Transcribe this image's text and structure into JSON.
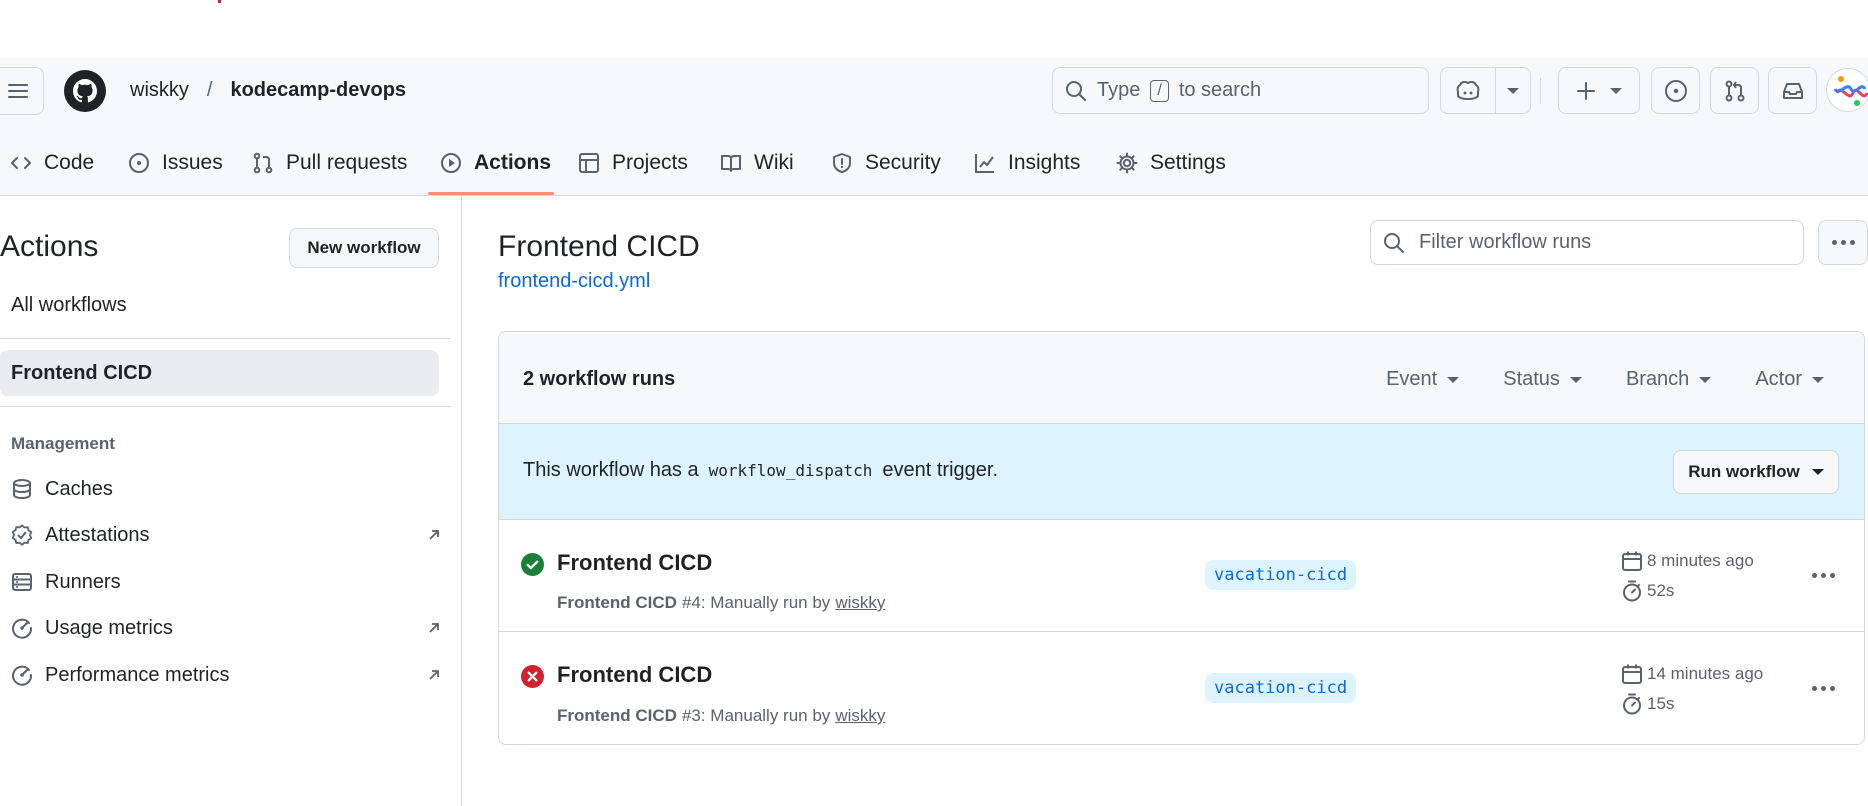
{
  "header": {
    "owner": "wiskky",
    "separator": "/",
    "repo": "kodecamp-devops",
    "search": {
      "prefix": "Type",
      "key": "/",
      "suffix": "to search"
    }
  },
  "tabs": [
    {
      "label": "Code",
      "icon": "code-icon"
    },
    {
      "label": "Issues",
      "icon": "issue-opened-icon"
    },
    {
      "label": "Pull requests",
      "icon": "git-pull-request-icon"
    },
    {
      "label": "Actions",
      "icon": "play-icon",
      "selected": true
    },
    {
      "label": "Projects",
      "icon": "table-icon"
    },
    {
      "label": "Wiki",
      "icon": "book-icon"
    },
    {
      "label": "Security",
      "icon": "shield-icon"
    },
    {
      "label": "Insights",
      "icon": "graph-icon"
    },
    {
      "label": "Settings",
      "icon": "gear-icon"
    }
  ],
  "sidebar": {
    "title": "Actions",
    "new_workflow": "New workflow",
    "all_workflows": "All workflows",
    "selected_workflow": "Frontend CICD",
    "management_heading": "Management",
    "management_items": [
      {
        "label": "Caches",
        "icon": "database-icon",
        "external": false
      },
      {
        "label": "Attestations",
        "icon": "verified-icon",
        "external": true
      },
      {
        "label": "Runners",
        "icon": "server-icon",
        "external": false
      },
      {
        "label": "Usage metrics",
        "icon": "meter-icon",
        "external": true
      },
      {
        "label": "Performance metrics",
        "icon": "meter-icon",
        "external": true
      }
    ]
  },
  "main": {
    "workflow_title": "Frontend CICD",
    "workflow_file": "frontend-cicd.yml",
    "filter_placeholder": "Filter workflow runs",
    "runs_count": "2 workflow runs",
    "filters": [
      "Event",
      "Status",
      "Branch",
      "Actor"
    ],
    "dispatch": {
      "prefix": "This workflow has a",
      "code": "workflow_dispatch",
      "suffix": "event trigger.",
      "button": "Run workflow"
    },
    "runs": [
      {
        "status": "success",
        "title": "Frontend CICD",
        "workflow": "Frontend CICD",
        "detail": "#4: Manually run by",
        "actor": "wiskky",
        "branch": "vacation-cicd",
        "time_ago": "8 minutes ago",
        "duration": "52s"
      },
      {
        "status": "failure",
        "title": "Frontend CICD",
        "workflow": "Frontend CICD",
        "detail": "#3: Manually run by",
        "actor": "wiskky",
        "branch": "vacation-cicd",
        "time_ago": "14 minutes ago",
        "duration": "15s"
      }
    ]
  },
  "colors": {
    "accent": "#0969da",
    "success": "#1a7f37",
    "failure": "#cf222e",
    "selected_tab_underline": "#fd8c73",
    "dispatch_bg": "#ddf4ff"
  }
}
